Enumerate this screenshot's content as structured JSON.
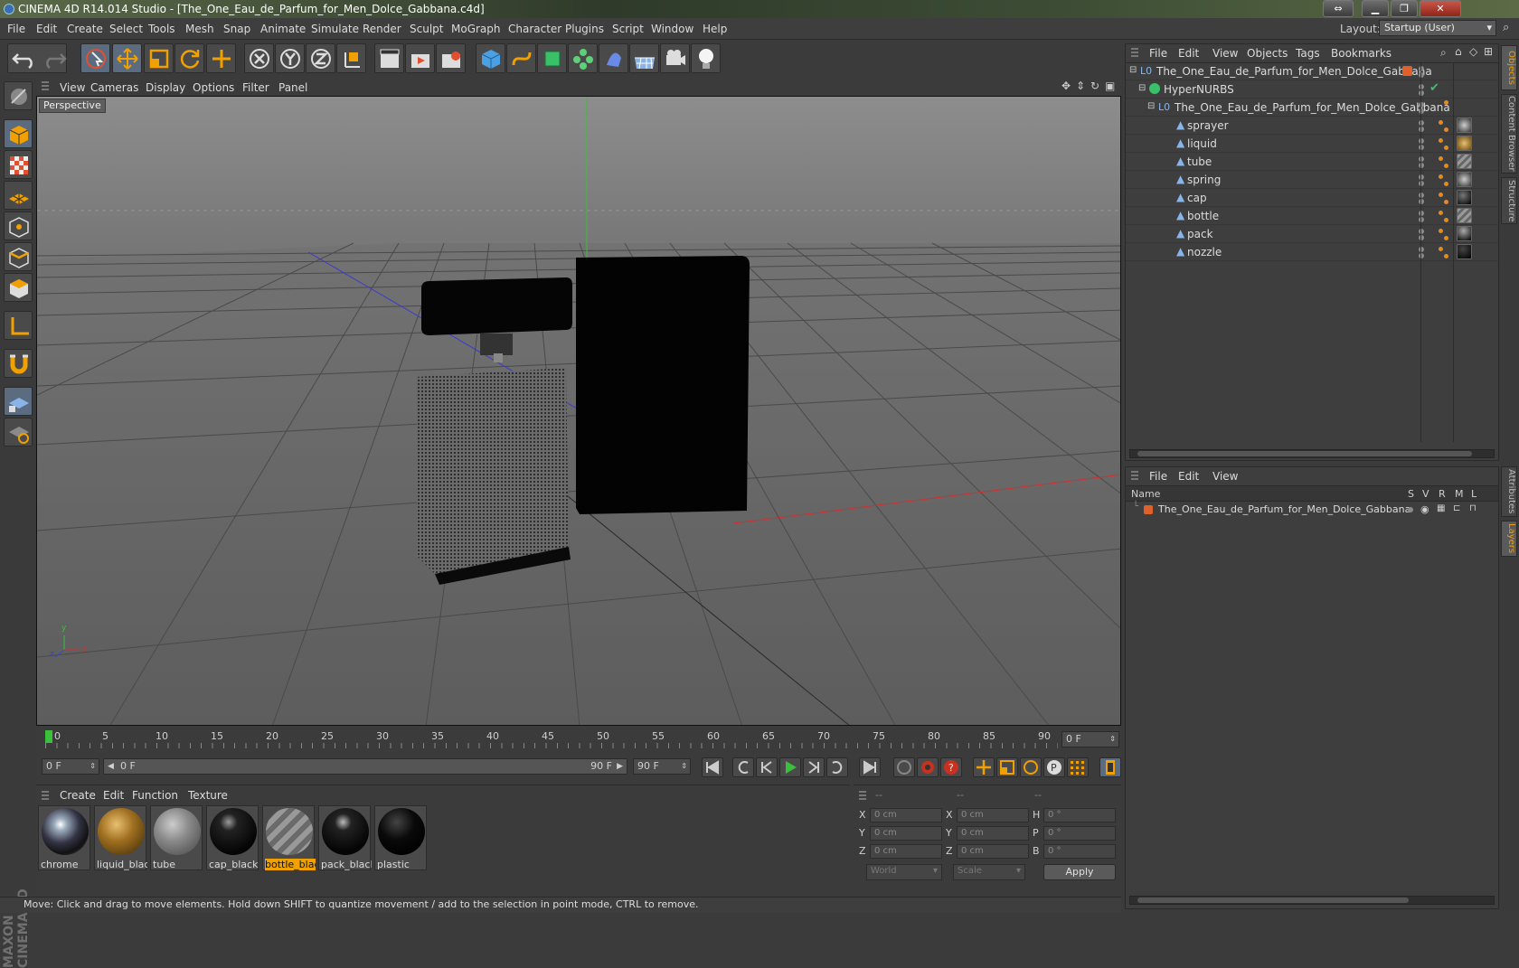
{
  "window": {
    "title": "CINEMA 4D R14.014 Studio - [The_One_Eau_de_Parfum_for_Men_Dolce_Gabbana.c4d]"
  },
  "menu": [
    "File",
    "Edit",
    "Create",
    "Select",
    "Tools",
    "Mesh",
    "Snap",
    "Animate",
    "Simulate",
    "Render",
    "Sculpt",
    "MoGraph",
    "Character",
    "Plugins",
    "Script",
    "Window",
    "Help"
  ],
  "layout": {
    "label": "Layout:",
    "value": "Startup (User)"
  },
  "viewport": {
    "menu": [
      "View",
      "Cameras",
      "Display",
      "Options",
      "Filter",
      "Panel"
    ],
    "label": "Perspective",
    "axis": {
      "y": "y",
      "x": "x",
      "z": "z"
    }
  },
  "timeline": {
    "ticks": [
      "0",
      "5",
      "10",
      "15",
      "20",
      "25",
      "30",
      "35",
      "40",
      "45",
      "50",
      "55",
      "60",
      "65",
      "70",
      "75",
      "80",
      "85",
      "90"
    ],
    "current_frame": "0 F"
  },
  "transport": {
    "start": "0 F",
    "range_start": "0 F",
    "range_end": "90 F",
    "end": "90 F"
  },
  "materials": {
    "menu": [
      "Create",
      "Edit",
      "Function",
      "Texture"
    ],
    "items": [
      {
        "name": "chrome"
      },
      {
        "name": "liquid_blac"
      },
      {
        "name": "tube"
      },
      {
        "name": "cap_black"
      },
      {
        "name": "bottle_blac"
      },
      {
        "name": "pack_black"
      },
      {
        "name": "plastic"
      }
    ]
  },
  "coordinates": {
    "col_headers": [
      "--",
      "--",
      "--"
    ],
    "rows": [
      {
        "a": "X",
        "av": "0 cm",
        "b": "X",
        "bv": "0 cm",
        "c": "H",
        "cv": "0 °"
      },
      {
        "a": "Y",
        "av": "0 cm",
        "b": "Y",
        "bv": "0 cm",
        "c": "P",
        "cv": "0 °"
      },
      {
        "a": "Z",
        "av": "0 cm",
        "b": "Z",
        "bv": "0 cm",
        "c": "B",
        "cv": "0 °"
      }
    ],
    "mode": "World",
    "type": "Scale",
    "apply": "Apply"
  },
  "status": "Move: Click and drag to move elements. Hold down SHIFT to quantize movement / add to the selection in point mode, CTRL to remove.",
  "objects": {
    "menu": [
      "File",
      "Edit",
      "View",
      "Objects",
      "Tags",
      "Bookmarks"
    ],
    "rows": [
      {
        "name": "The_One_Eau_de_Parfum_for_Men_Dolce_Gabbana",
        "indent": 0
      },
      {
        "name": "HyperNURBS",
        "indent": 1
      },
      {
        "name": "The_One_Eau_de_Parfum_for_Men_Dolce_Gabbana",
        "indent": 2
      },
      {
        "name": "sprayer",
        "indent": 3
      },
      {
        "name": "liquid",
        "indent": 3
      },
      {
        "name": "tube",
        "indent": 3
      },
      {
        "name": "spring",
        "indent": 3
      },
      {
        "name": "cap",
        "indent": 3
      },
      {
        "name": "bottle",
        "indent": 3
      },
      {
        "name": "pack",
        "indent": 3
      },
      {
        "name": "nozzle",
        "indent": 3
      }
    ]
  },
  "layers": {
    "menu": [
      "File",
      "Edit",
      "View"
    ],
    "headers": {
      "name": "Name",
      "s": "S",
      "v": "V",
      "r": "R",
      "m": "M",
      "l": "L"
    },
    "rows": [
      {
        "name": "The_One_Eau_de_Parfum_for_Men_Dolce_Gabbana"
      }
    ]
  },
  "side_tabs": [
    "Objects",
    "Content Browser",
    "Structure",
    "Attributes",
    "Layers"
  ],
  "brand": "MAXON CINEMA 4D",
  "colors": {
    "accent": "#f0a000",
    "selection": "#5b6b80",
    "layer": "#e0602a"
  }
}
